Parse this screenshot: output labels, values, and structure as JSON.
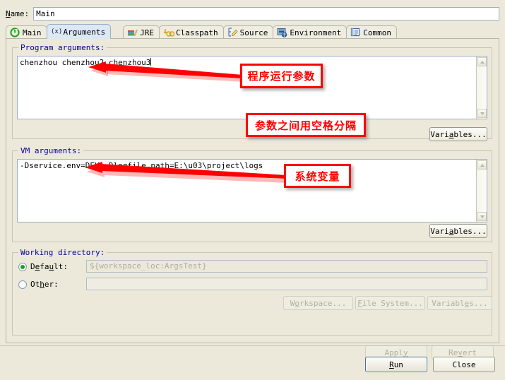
{
  "window": {
    "name_label": "Name:",
    "name_value": "Main"
  },
  "tabs": [
    {
      "label": "Main",
      "icon": "main-run-icon",
      "selected": false
    },
    {
      "label": "Arguments",
      "icon": "arguments-icon",
      "selected": true
    },
    {
      "label": "JRE",
      "icon": "jre-icon",
      "selected": false
    },
    {
      "label": "Classpath",
      "icon": "classpath-icon",
      "selected": false
    },
    {
      "label": "Source",
      "icon": "source-icon",
      "selected": false
    },
    {
      "label": "Environment",
      "icon": "environment-icon",
      "selected": false
    },
    {
      "label": "Common",
      "icon": "common-icon",
      "selected": false
    }
  ],
  "program_arguments": {
    "group_title": "Program arguments:",
    "value": "chenzhou chenzhou2 chenzhou3",
    "variables_button": "Variables..."
  },
  "vm_arguments": {
    "group_title": "VM arguments:",
    "value": "-Dservice.env=DEV -Dlogfile.path=E:\\u03\\project\\logs",
    "variables_button": "Variables..."
  },
  "working_directory": {
    "group_title": "Working directory:",
    "default_label": "Default:",
    "default_value": "${workspace_loc:ArgsTest}",
    "other_label": "Other:",
    "other_value": "",
    "default_selected": true,
    "workspace_button": "Workspace...",
    "file_system_button": "File System...",
    "variables_button": "Variables..."
  },
  "footer": {
    "apply_button": "Apply",
    "revert_button": "Revert",
    "run_button": "Run",
    "close_button": "Close"
  },
  "annotations": [
    {
      "text": "程序运行参数",
      "points_to": "program-arguments-text"
    },
    {
      "text": "参数之间用空格分隔",
      "points_to": "program-arguments-group"
    },
    {
      "text": "系统变量",
      "points_to": "vm-arguments-text"
    }
  ],
  "colors": {
    "background": "#ECE9DA",
    "group_title": "#00009A",
    "annotation": "#FF0000",
    "selected_tab": "#DCE8F5"
  }
}
